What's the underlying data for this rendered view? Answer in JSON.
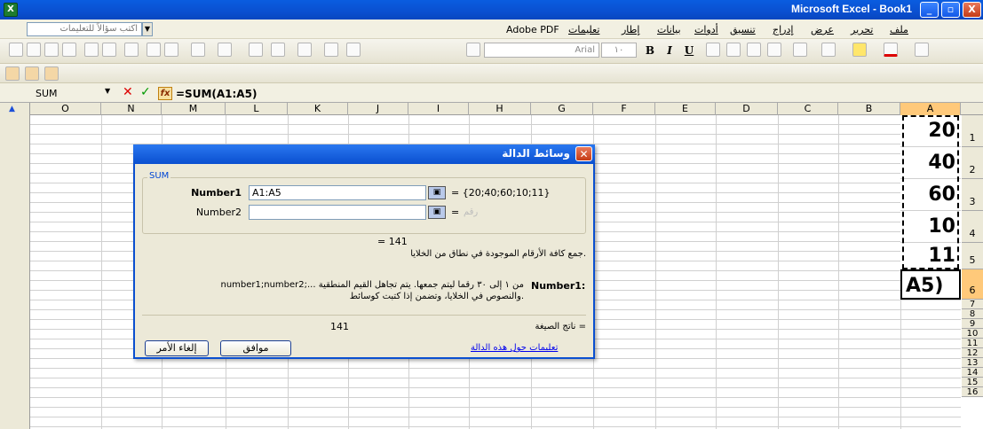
{
  "window": {
    "title": "Microsoft Excel - Book1",
    "min": "_",
    "max": "▫",
    "close": "X"
  },
  "menu": {
    "help_placeholder": "اكتب سؤالاً للتعليمات",
    "items": [
      "ملف",
      "تحرير",
      "عرض",
      "إدراج",
      "تنسيق",
      "أدوات",
      "بيانات",
      "إطار",
      "تعليمات",
      "Adobe PDF"
    ]
  },
  "toolbar": {
    "font": "Arial",
    "size": "١٠",
    "bold": "B",
    "italic": "I",
    "underline": "U"
  },
  "formula_bar": {
    "name_box": "SUM",
    "cancel": "✕",
    "enter": "✓",
    "fx": "fx",
    "formula": "=SUM(A1:A5)"
  },
  "columns": [
    "O",
    "N",
    "M",
    "L",
    "K",
    "J",
    "I",
    "H",
    "G",
    "F",
    "E",
    "D",
    "C",
    "B",
    "A"
  ],
  "rows": [
    "1",
    "2",
    "3",
    "4",
    "5",
    "6",
    "7",
    "8",
    "9",
    "10",
    "11",
    "12",
    "13",
    "14",
    "15",
    "16"
  ],
  "cells": [
    "20",
    "40",
    "60",
    "10",
    "11",
    "A5)"
  ],
  "dialog": {
    "title": "وسائط الدالة",
    "group": "SUM",
    "arg1_label": "Number1",
    "arg1_value": "A1:A5",
    "arg1_result": "= {20;40;60;10;11}",
    "arg2_label": "Number2",
    "arg2_value": "",
    "arg2_result": "=",
    "arg2_hint": "رقم",
    "result": "= 141",
    "description": "جمع كافة الأرقام الموجودة في نطاق من الخلايا.",
    "arg_help_label": "Number1:",
    "arg_help_line1": "number1;number2;... من ١ إلى ٣٠ رقماً ليتم جمعها. يتم تجاهل القيم المنطقية",
    "arg_help_line2": "والنصوص في الخلايا، وتضمن إذا كتبت كوسائط.",
    "formula_result_label": "ناتج الصيغة =",
    "formula_result_value": "141",
    "help_link": "تعليمات حول هذه الدالة",
    "ok": "موافق",
    "cancel": "إلغاء الأمر"
  }
}
